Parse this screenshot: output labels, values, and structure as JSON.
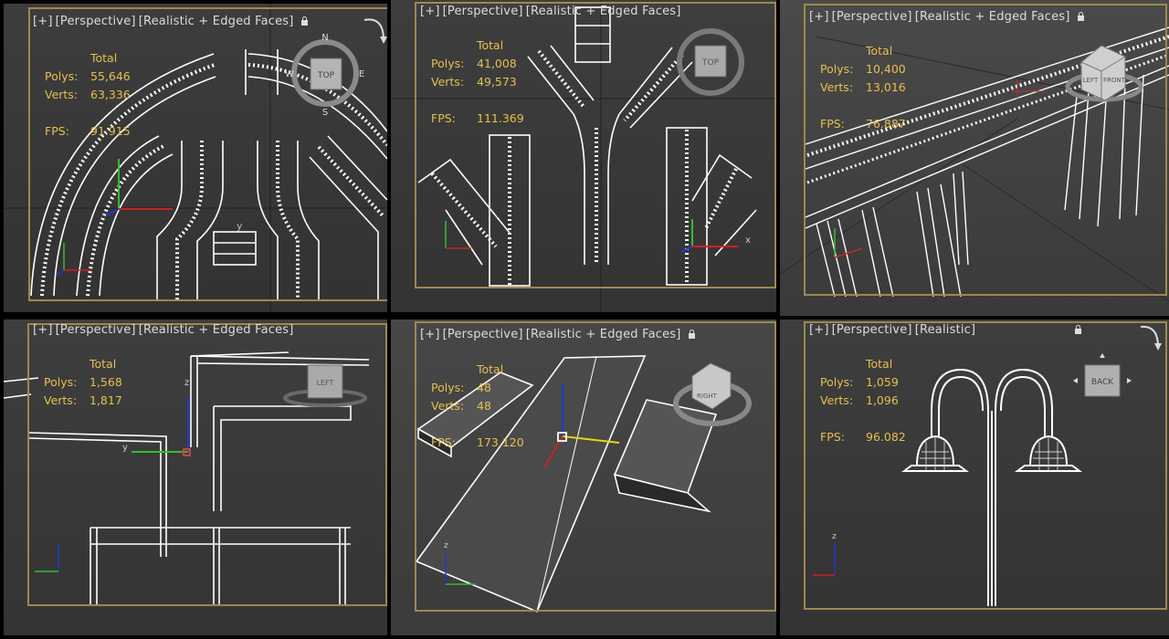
{
  "viewports": [
    {
      "label": {
        "plus": "[+]",
        "view": "[Perspective]",
        "shading": "[Realistic + Edged Faces]"
      },
      "stats": {
        "total": "Total",
        "polys_label": "Polys:",
        "polys": "55,646",
        "verts_label": "Verts:",
        "verts": "63,336",
        "fps_label": "FPS:",
        "fps": "91.915"
      },
      "viewcube": {
        "face": "TOP",
        "n": "N",
        "s": "S",
        "e": "E",
        "w": "W"
      },
      "axes": {
        "y": "y"
      }
    },
    {
      "label": {
        "plus": "[+]",
        "view": "[Perspective]",
        "shading": "[Realistic + Edged Faces]"
      },
      "stats": {
        "total": "Total",
        "polys_label": "Polys:",
        "polys": "41,008",
        "verts_label": "Verts:",
        "verts": "49,573",
        "fps_label": "FPS:",
        "fps": "111.369"
      },
      "viewcube": {
        "face": "TOP"
      },
      "axes": {
        "x": "x"
      }
    },
    {
      "label": {
        "plus": "[+]",
        "view": "[Perspective]",
        "shading": "[Realistic + Edged Faces]"
      },
      "stats": {
        "total": "Total",
        "polys_label": "Polys:",
        "polys": "10,400",
        "verts_label": "Verts:",
        "verts": "13,016",
        "fps_label": "FPS:",
        "fps": "76.887"
      },
      "viewcube": {
        "face1": "LEFT",
        "face2": "FRONT"
      }
    },
    {
      "label": {
        "plus": "[+]",
        "view": "[Perspective]",
        "shading": "[Realistic + Edged Faces]"
      },
      "stats": {
        "total": "Total",
        "polys_label": "Polys:",
        "polys": "1,568",
        "verts_label": "Verts:",
        "verts": "1,817"
      },
      "viewcube": {
        "face": "LEFT"
      },
      "axes": {
        "z": "z",
        "y": "y"
      }
    },
    {
      "label": {
        "plus": "[+]",
        "view": "[Perspective]",
        "shading": "[Realistic + Edged Faces]"
      },
      "stats": {
        "total": "Total",
        "polys_label": "Polys:",
        "polys": "48",
        "verts_label": "Verts:",
        "verts": "48",
        "fps_label": "FPS:",
        "fps": "173.120"
      },
      "viewcube": {
        "face": "RIGHT"
      },
      "axes": {
        "z": "z"
      }
    },
    {
      "label": {
        "plus": "[+]",
        "view": "[Perspective]",
        "shading": "[Realistic]"
      },
      "stats": {
        "total": "Total",
        "polys_label": "Polys:",
        "polys": "1,059",
        "verts_label": "Verts:",
        "verts": "1,096",
        "fps_label": "FPS:",
        "fps": "96.082"
      },
      "viewcube": {
        "face": "BACK"
      },
      "axes": {
        "z": "z"
      }
    }
  ],
  "colors": {
    "stats": "#e6c14a",
    "border": "#9c8a4a",
    "label": "#dcdcdc"
  }
}
